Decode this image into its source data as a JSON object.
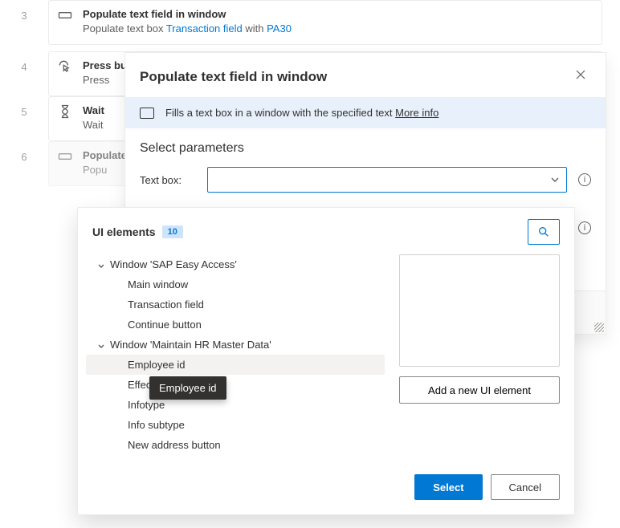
{
  "steps": [
    {
      "num": "3",
      "title": "Populate text field in window",
      "sub_a": "Populate text box ",
      "sub_link": "Transaction field",
      "sub_b": " with ",
      "sub_link2": "PA30"
    },
    {
      "num": "4",
      "title": "Press button in window",
      "sub_a": "Press"
    },
    {
      "num": "5",
      "title": "Wait",
      "sub_a": "Wait"
    },
    {
      "num": "6",
      "title": "Populate text field in window",
      "sub_a": "Popu"
    }
  ],
  "dialog": {
    "title": "Populate text field in window",
    "info_text": "Fills a text box in a window with the specified text ",
    "info_link": "More info",
    "section_title": "Select parameters",
    "param_label": "Text box:"
  },
  "picker": {
    "title": "UI elements",
    "count": "10",
    "groups": [
      {
        "label": "Window 'SAP Easy Access'",
        "items": [
          "Main window",
          "Transaction field",
          "Continue button"
        ]
      },
      {
        "label": "Window 'Maintain HR Master Data'",
        "items": [
          "Employee id",
          "Effective",
          "Infotype",
          "Info subtype",
          "New address button"
        ],
        "highlight_index": 0
      }
    ],
    "add_label": "Add a new UI element",
    "select_label": "Select",
    "cancel_label": "Cancel"
  },
  "tooltip": "Employee id"
}
